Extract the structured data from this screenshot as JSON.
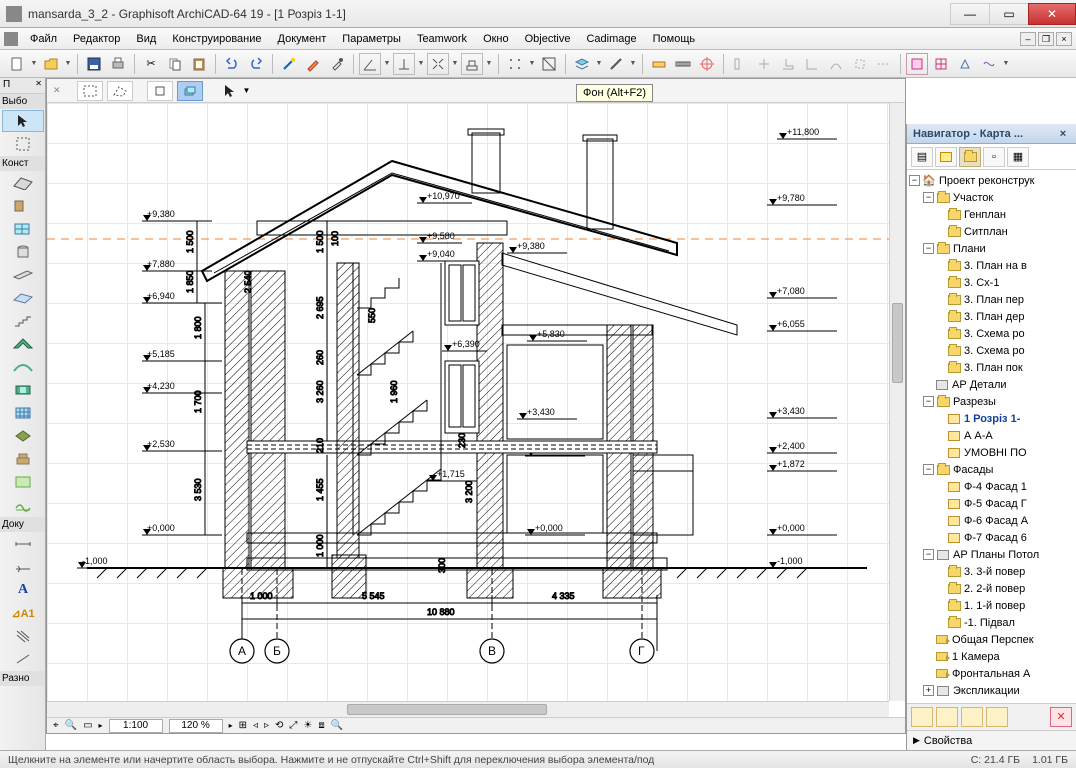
{
  "window": {
    "title": "mansarda_3_2 - Graphisoft ArchiCAD-64 19 - [1 Розріз 1-1]"
  },
  "menu": [
    "Файл",
    "Редактор",
    "Вид",
    "Конструирование",
    "Документ",
    "Параметры",
    "Teamwork",
    "Окно",
    "Objective",
    "Cadimage",
    "Помощь"
  ],
  "tooltip": "Фон (Alt+F2)",
  "left_tabs": {
    "t1": "П",
    "t2": "Выбо",
    "t3": "Конст",
    "t4": "Доку",
    "t5": "Разно"
  },
  "navigator": {
    "title": "Навигатор - Карта ...",
    "root": "Проект реконструк",
    "nodes": {
      "uchastok": "Участок",
      "genplan": "Генплан",
      "sitplan": "Ситплан",
      "plany": "Плани",
      "p3": "3. План на в",
      "cx1": "3. Сх-1",
      "pper": "3. План пер",
      "pder": "3. План дер",
      "sroz1": "3. Схема ро",
      "sroz2": "3. Схема ро",
      "ppok": "3. План пок",
      "apdet": "АР Детали",
      "razr": "Разрезы",
      "r11": "1 Розріз 1-",
      "aa": "А А-А",
      "umov": "УМОВНІ ПО",
      "fasady": "Фасады",
      "f4": "Ф-4 Фасад 1",
      "f5": "Ф-5 Фасад Г",
      "f6": "Ф-6 Фасад А",
      "f7": "Ф-7 Фасад 6",
      "app": "АР Планы Потол",
      "p3p": "3. 3-й повер",
      "p2p": "2. 2-й повер",
      "p1p": "1. 1-й повер",
      "pidv": "-1. Підвал",
      "persp": "Общая Перспек",
      "cam1": "1 Камера",
      "front": "Фронтальная А",
      "expl": "Экспликации"
    },
    "props": "Свойства"
  },
  "bottom": {
    "scale": "1:100",
    "zoom": "120 %"
  },
  "status": {
    "msg": "Щелкните на элементе или начертите область выбора. Нажмите и не отпускайте Ctrl+Shift для переключения выбора элемента/под",
    "c": "C: 21.4 ГБ",
    "d": "1.01 ГБ"
  },
  "elev": {
    "l9380": "+9,380",
    "l7880": "+7,880",
    "l6940": "+6,940",
    "l5185": "+5,185",
    "l4230": "+4,230",
    "l2530": "+2,530",
    "l0000": "+0,000",
    "lm1000": "-1,000",
    "r11800": "+11,800",
    "r9780": "+9,780",
    "r9380": "+9,380",
    "r7080": "+7,080",
    "r6055": "+6,055",
    "r3430": "+3,430",
    "r2400": "+2,400",
    "r1872": "+1,872",
    "r0000": "+0,000",
    "rm1000": "-1,000",
    "m10970": "+10,970",
    "m9580": "+9,580",
    "m9040": "+9,040",
    "m6390": "+6,390",
    "m5830": "+5,830",
    "m3430": "+3,430",
    "m3200": "+3,200",
    "m1715": "+1,715",
    "d1500a": "1 500",
    "d1500b": "1 500",
    "d100": "100",
    "d1850": "1 850",
    "d1800": "1 800",
    "d1700": "1 700",
    "d3530": "3 530",
    "d2540": "2 540",
    "d2695": "2 695",
    "d550a": "550",
    "d260a": "260",
    "d3260": "3 260",
    "d1960": "1 960",
    "d210": "210",
    "d1455": "1 455",
    "d1000": "1 000",
    "d300": "300",
    "d230": "230",
    "d3200": "3 200",
    "b1000": "1 000",
    "b5545": "5 545",
    "b4335": "4 335",
    "b10880": "10 880",
    "ax_a": "А",
    "ax_b": "Б",
    "ax_v": "В",
    "ax_g": "Г"
  }
}
